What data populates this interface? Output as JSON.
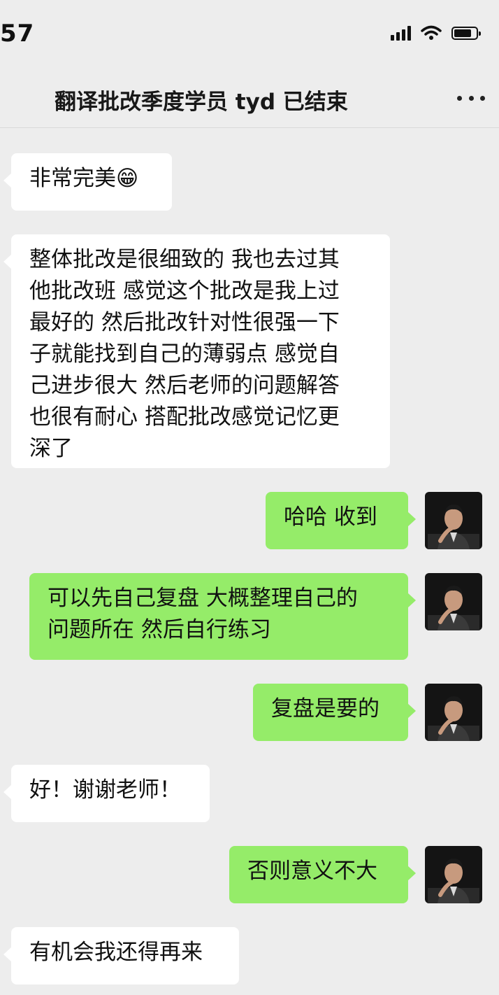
{
  "status_bar": {
    "time": "57",
    "battery_level": 0.8
  },
  "header": {
    "title": "翻译批改季度学员 tyd 已结束",
    "more_icon": "more-horizontal-icon"
  },
  "messages": [
    {
      "side": "in",
      "text": "非常完美😁"
    },
    {
      "side": "in",
      "text": "整体批改是很细致的 我也去过其\n他批改班 感觉这个批改是我上过\n最好的 然后批改针对性很强一下\n子就能找到自己的薄弱点 感觉自\n己进步很大 然后老师的问题解答\n也很有耐心 搭配批改感觉记忆更\n深了"
    },
    {
      "side": "out",
      "text": "哈哈 收到"
    },
    {
      "side": "out",
      "text": "可以先自己复盘 大概整理自己的\n问题所在 然后自行练习"
    },
    {
      "side": "out",
      "text": "复盘是要的"
    },
    {
      "side": "in",
      "text": "好！谢谢老师！"
    },
    {
      "side": "out",
      "text": "否则意义不大"
    },
    {
      "side": "in",
      "text": "有机会我还得再来"
    }
  ],
  "colors": {
    "background": "#ededed",
    "incoming_bubble": "#ffffff",
    "outgoing_bubble": "#95ec69"
  }
}
